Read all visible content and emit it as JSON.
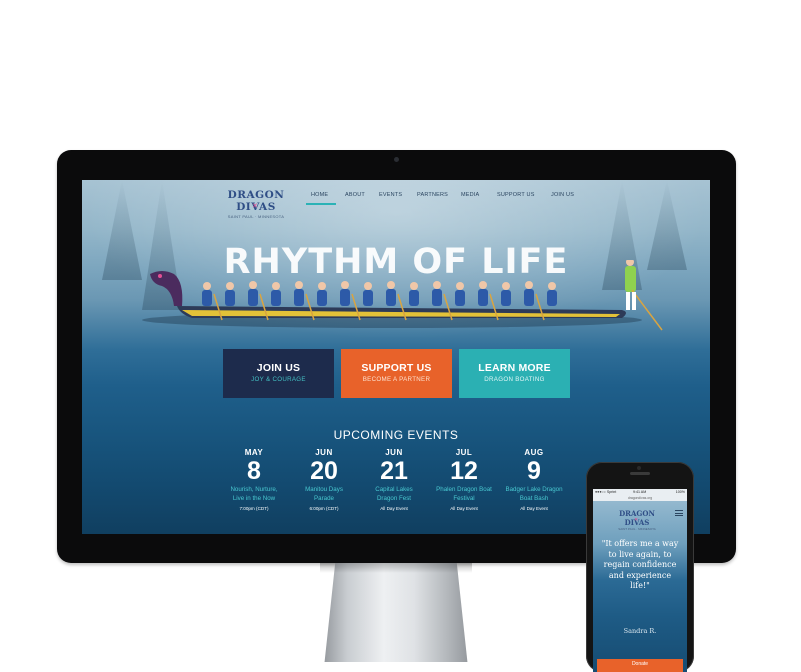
{
  "site": {
    "logo_text": "DRAGON DIVAS",
    "logo_tagline": "SAINT PAUL · MINNESOTA",
    "nav": [
      {
        "label": "HOME",
        "active": true
      },
      {
        "label": "ABOUT"
      },
      {
        "label": "EVENTS"
      },
      {
        "label": "PARTNERS"
      },
      {
        "label": "MEDIA"
      },
      {
        "label": "SUPPORT US"
      },
      {
        "label": "JOIN US"
      }
    ],
    "hero_title": "RHYTHM OF LIFE",
    "cta": [
      {
        "title": "JOIN US",
        "subtitle": "JOY & COURAGE",
        "color": "#1d2b4c"
      },
      {
        "title": "SUPPORT US",
        "subtitle": "BECOME A PARTNER",
        "color": "#e8622a"
      },
      {
        "title": "LEARN MORE",
        "subtitle": "DRAGON BOATING",
        "color": "#2bb0b3"
      }
    ],
    "events_heading": "UPCOMING EVENTS",
    "events": [
      {
        "month": "MAY",
        "day": "8",
        "name_line1": "Nourish, Nurture,",
        "name_line2": "Live in the Now",
        "time": "7:00pm (CDT)"
      },
      {
        "month": "JUN",
        "day": "20",
        "name_line1": "Manitou Days",
        "name_line2": "Parade",
        "time": "6:00pm (CDT)"
      },
      {
        "month": "JUN",
        "day": "21",
        "name_line1": "Capital Lakes",
        "name_line2": "Dragon Fest",
        "time": "All Day Event"
      },
      {
        "month": "JUL",
        "day": "12",
        "name_line1": "Phalen Dragon Boat",
        "name_line2": "Festival",
        "time": "All Day Event"
      },
      {
        "month": "AUG",
        "day": "9",
        "name_line1": "Badger Lake Dragon",
        "name_line2": "Boat Bash",
        "time": "All Day Event"
      }
    ]
  },
  "mobile": {
    "status_carrier": "●●●○○ Sprint",
    "status_time": "9:41 AM",
    "status_battery": "100%",
    "url": "dragondivas.org",
    "logo_text": "DRAGON DIVAS",
    "logo_tagline": "SAINT PAUL · MINNESOTA",
    "quote": "\"It offers me a way to live again, to regain confidence and experience life!\"",
    "author": "Sandra R.",
    "donate_label": "Donate"
  },
  "colors": {
    "accent_teal": "#2bb2b6",
    "accent_orange": "#e8622a",
    "navy": "#1d2b4c",
    "logo_pink": "#e44f93"
  }
}
